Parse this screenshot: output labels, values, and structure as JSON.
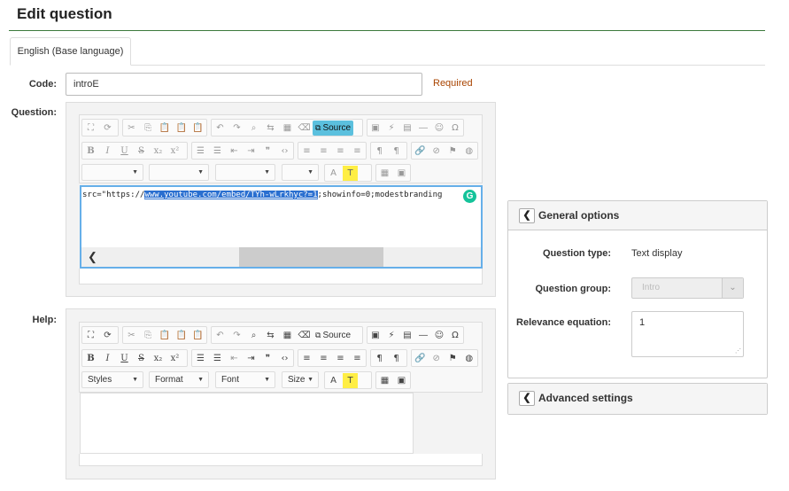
{
  "page_title": "Edit question",
  "tabs": [
    {
      "label": "English (Base language)"
    }
  ],
  "code": {
    "label": "Code:",
    "value": "introE",
    "required_text": "Required"
  },
  "question": {
    "label": "Question:",
    "source_label": "Source",
    "code_pre": "src=\"https://",
    "code_highlight": "www.youtube.com/embed/TYh-wLrkhyc?=1",
    "code_post": ";showinfo=0;modestbranding"
  },
  "help": {
    "label": "Help:",
    "source_label": "Source",
    "combos": {
      "styles": "Styles",
      "format": "Format",
      "font": "Font",
      "size": "Size"
    }
  },
  "general_options": {
    "title": "General options",
    "question_type_label": "Question type:",
    "question_type_value": "Text display",
    "question_group_label": "Question group:",
    "question_group_value": "Intro",
    "relevance_label": "Relevance equation:",
    "relevance_value": "1"
  },
  "advanced_settings": {
    "title": "Advanced settings"
  },
  "colors": {
    "accent_green": "#3c7a3c",
    "required": "#a94400",
    "source_active": "#5bc0de",
    "selection": "#2a6fd0"
  }
}
